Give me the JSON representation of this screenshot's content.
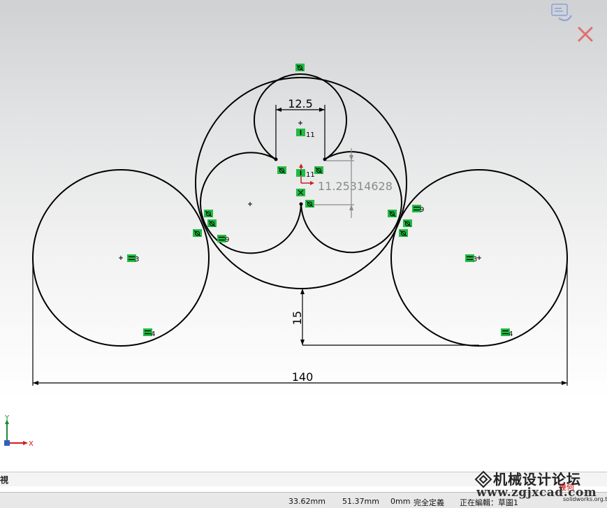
{
  "dimensions": {
    "top_width": "12.5",
    "driven_height": "11.25314628",
    "vertical_offset": "15",
    "overall_width": "140"
  },
  "relations": {
    "coincident_3": "3",
    "coincident_4": "4",
    "equal_9": "9",
    "vertical_11": "11"
  },
  "triad": {
    "x_label": "X",
    "y_label": "Y"
  },
  "view_tab": {
    "label": "視"
  },
  "status": {
    "x_coord": "33.62mm",
    "y_coord": "51.37mm",
    "z_coord": "0mm",
    "definition_state": "完全定義",
    "editing": "正在編輯：草圖1"
  },
  "watermark": {
    "site_name": "机械设计论坛",
    "url": "www.zgjxcad.com",
    "logo_label": "幾何",
    "sub_url": "solidworks.org.tw"
  },
  "colors": {
    "sketch_line": "#000000",
    "relation_badge": "#22bb44",
    "driven_dim": "#8a8a8a",
    "origin_red": "#cc2020",
    "axis_y": "#1f8a3a",
    "axis_x": "#cc2020"
  },
  "icons": [
    "confirm-corner-icon",
    "cancel-corner-icon",
    "origin-axis-icon"
  ]
}
